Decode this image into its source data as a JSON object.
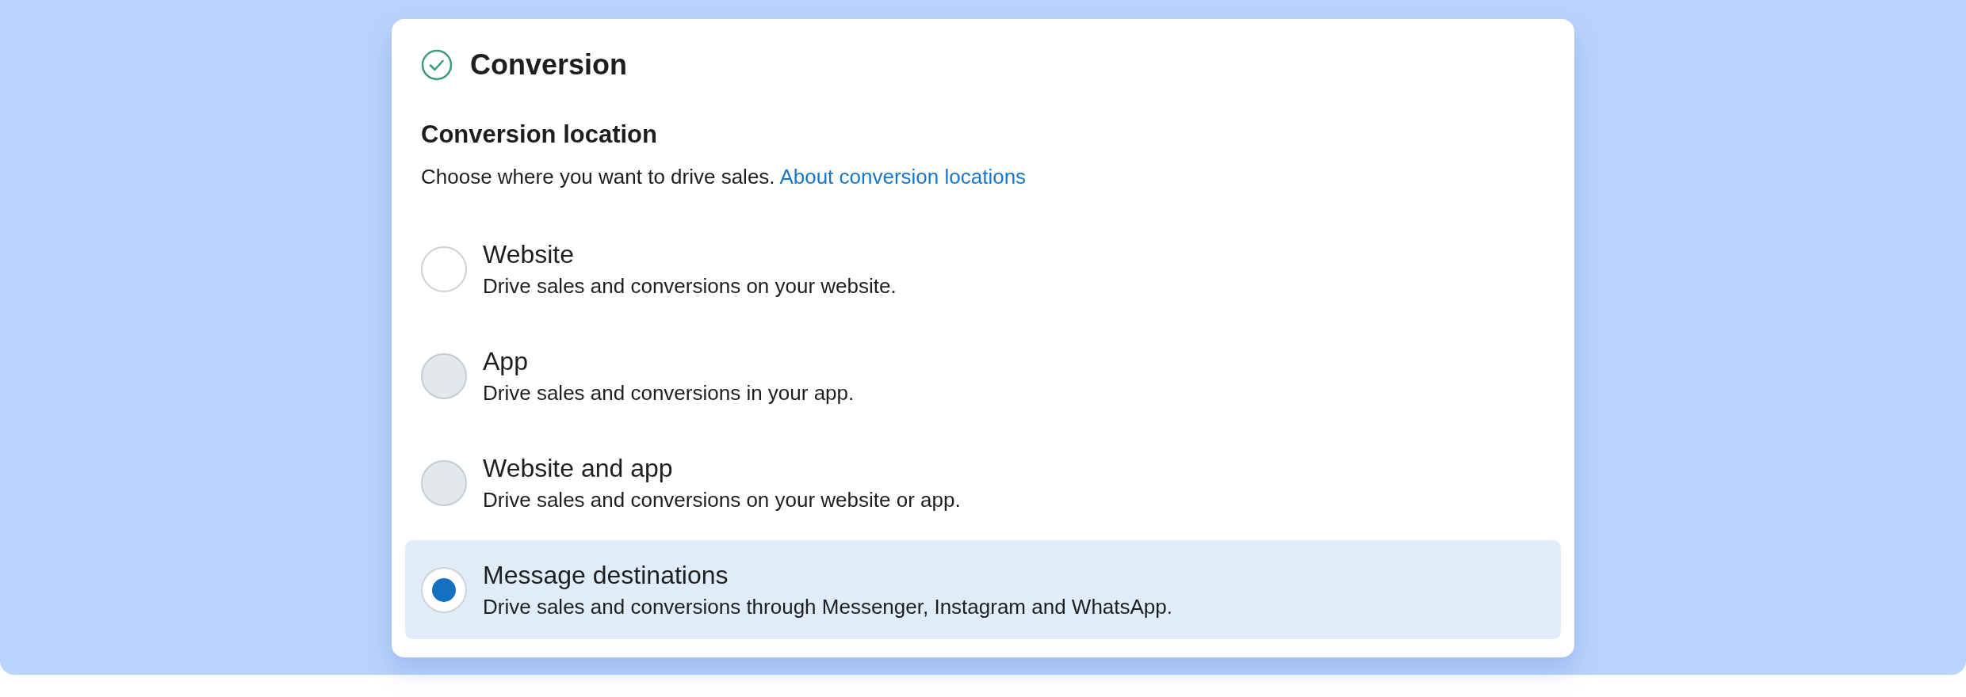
{
  "section": {
    "title": "Conversion",
    "complete": true
  },
  "location": {
    "heading": "Conversion location",
    "description": "Choose where you want to drive sales.",
    "link": "About conversion locations"
  },
  "options": [
    {
      "label": "Website",
      "description": "Drive sales and conversions on your website.",
      "selected": false,
      "disabled": false
    },
    {
      "label": "App",
      "description": "Drive sales and conversions in your app.",
      "selected": false,
      "disabled": true
    },
    {
      "label": "Website and app",
      "description": "Drive sales and conversions on your website or app.",
      "selected": false,
      "disabled": true
    },
    {
      "label": "Message destinations",
      "description": "Drive sales and conversions through Messenger, Instagram and WhatsApp.",
      "selected": true,
      "disabled": false
    }
  ]
}
